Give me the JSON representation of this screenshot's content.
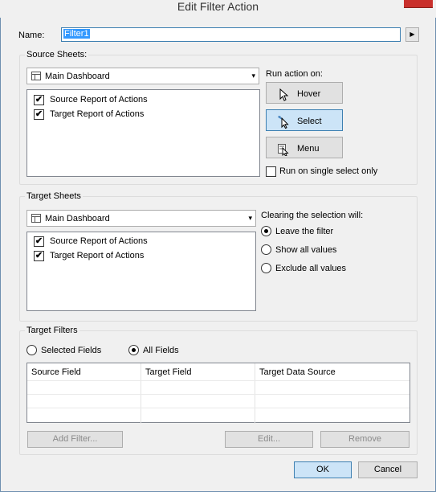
{
  "window": {
    "title": "Edit Filter Action"
  },
  "name": {
    "label": "Name:",
    "value": "Filter1",
    "menu_arrow": "▶"
  },
  "source_sheets": {
    "title": "Source Sheets:",
    "dashboard": "Main Dashboard",
    "items": [
      {
        "label": "Source Report of Actions",
        "checked": true
      },
      {
        "label": "Target Report of Actions",
        "checked": true
      }
    ]
  },
  "run_action": {
    "title": "Run action on:",
    "buttons": [
      {
        "label": "Hover",
        "icon": "pointer-icon",
        "active": false
      },
      {
        "label": "Select",
        "icon": "select-pointer-icon",
        "active": true
      },
      {
        "label": "Menu",
        "icon": "menu-pointer-icon",
        "active": false
      }
    ],
    "single_select_label": "Run on single select only",
    "single_select_checked": false
  },
  "target_sheets": {
    "title": "Target Sheets",
    "dashboard": "Main Dashboard",
    "items": [
      {
        "label": "Source Report of Actions",
        "checked": true
      },
      {
        "label": "Target Report of Actions",
        "checked": true
      }
    ]
  },
  "clearing": {
    "title": "Clearing the selection will:",
    "options": [
      {
        "label": "Leave the filter",
        "selected": true
      },
      {
        "label": "Show all values",
        "selected": false
      },
      {
        "label": "Exclude all values",
        "selected": false
      }
    ]
  },
  "target_filters": {
    "title": "Target Filters",
    "options": [
      {
        "label": "Selected Fields",
        "selected": false
      },
      {
        "label": "All Fields",
        "selected": true
      }
    ],
    "columns": [
      "Source Field",
      "Target Field",
      "Target Data Source"
    ],
    "add_filter": "Add Filter...",
    "edit": "Edit...",
    "remove": "Remove"
  },
  "footer": {
    "ok": "OK",
    "cancel": "Cancel"
  },
  "colors": {
    "accent": "#3c7fb1",
    "selection": "#3399ff",
    "active_button": "#cce4f7",
    "close": "#c9302c"
  },
  "icons": {
    "checkmark": "✔",
    "dropdown": "▾"
  }
}
